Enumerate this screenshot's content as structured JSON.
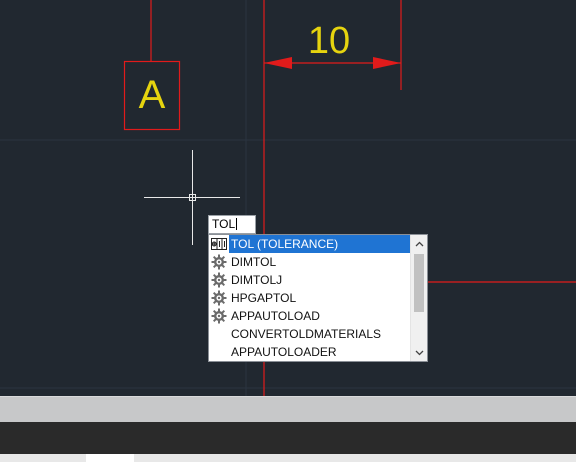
{
  "drawing": {
    "dimension_text": "10",
    "tag_text": "A",
    "colors": {
      "background": "#212830",
      "grid": "#2b3440",
      "red": "#e11b1b",
      "yellow": "#e6d40f",
      "crosshair": "#e8e8e8"
    }
  },
  "command_line": {
    "typed": "TOL"
  },
  "autocomplete": {
    "items": [
      {
        "label": "TOL (TOLERANCE)",
        "icon": "tolerance-icon",
        "selected": true
      },
      {
        "label": "DIMTOL",
        "icon": "gear-icon",
        "selected": false
      },
      {
        "label": "DIMTOLJ",
        "icon": "gear-icon",
        "selected": false
      },
      {
        "label": "HPGAPTOL",
        "icon": "gear-icon",
        "selected": false
      },
      {
        "label": "APPAUTOLOAD",
        "icon": "gear-icon",
        "selected": false
      },
      {
        "label": "CONVERTOLDMATERIALS",
        "icon": "",
        "selected": false
      },
      {
        "label": "APPAUTOLOADER",
        "icon": "",
        "selected": false
      }
    ],
    "accent_color": "#1f74d3"
  }
}
